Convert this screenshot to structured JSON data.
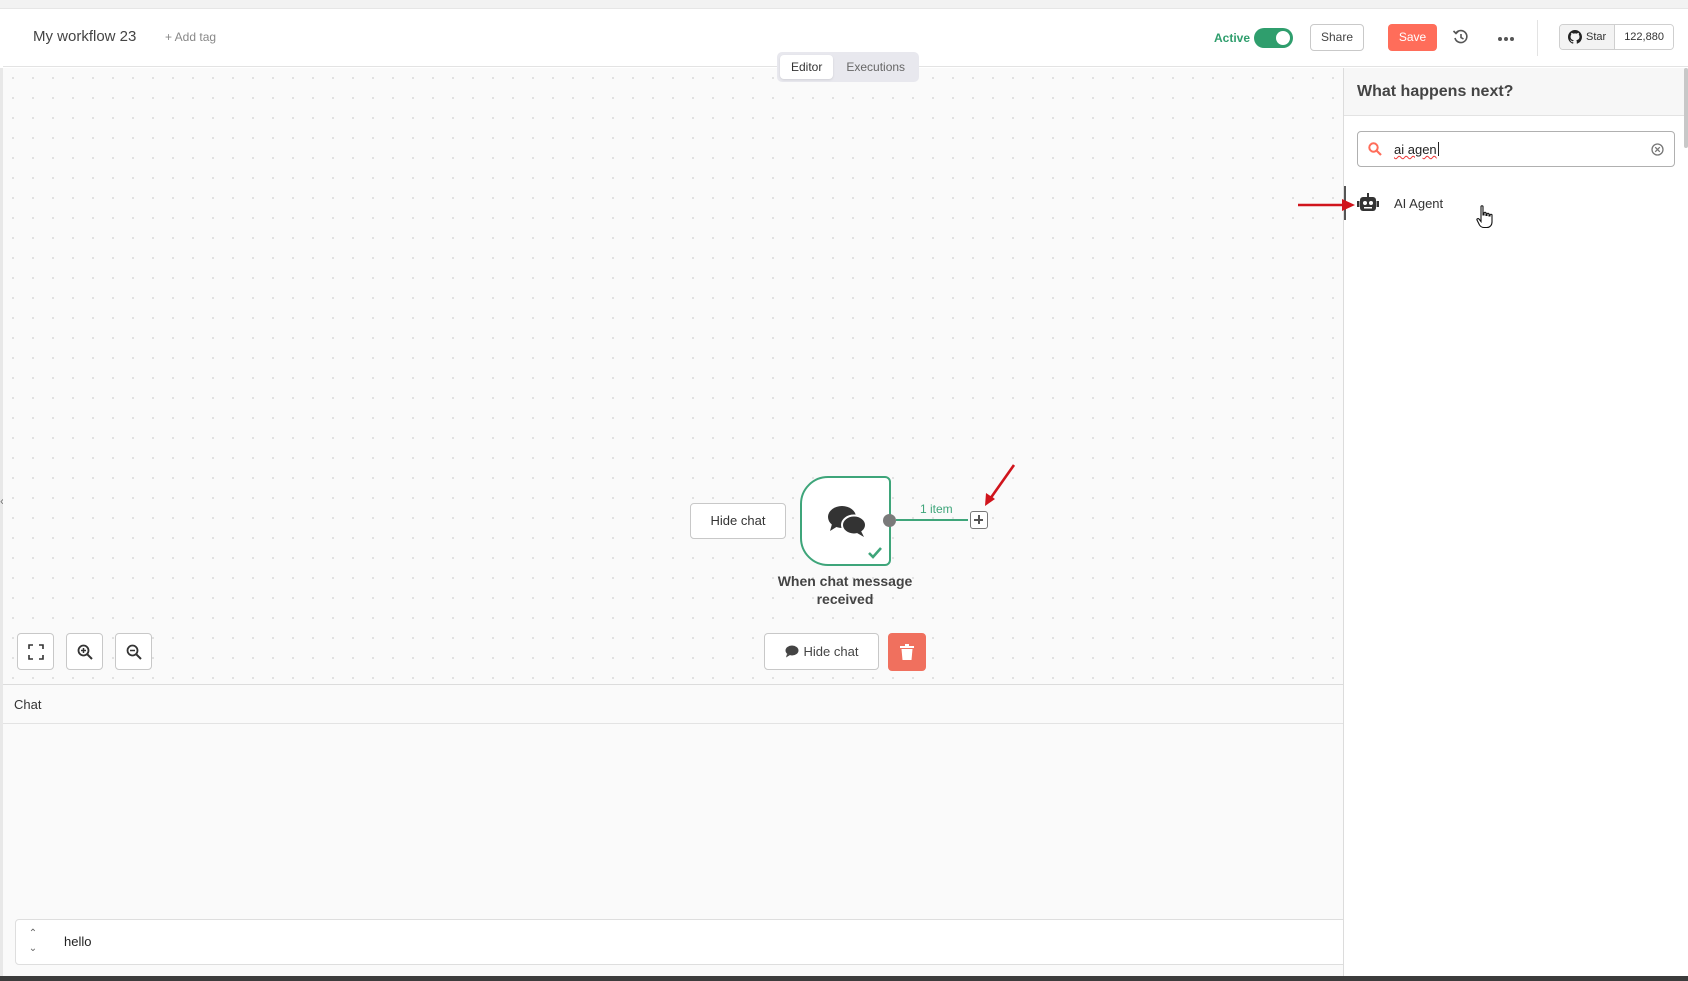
{
  "header": {
    "workflow_name": "My workflow 23",
    "add_tag": "+ Add tag",
    "active_label": "Active",
    "active": true,
    "share_label": "Share",
    "save_label": "Save",
    "github_star_label": "Star",
    "github_star_count": "122,880"
  },
  "tabs": [
    {
      "label": "Editor",
      "active": true
    },
    {
      "label": "Executions",
      "active": false
    }
  ],
  "canvas": {
    "node_hide_chat_label": "Hide chat",
    "node_title": "When chat message received",
    "node_status": "success",
    "connection_label": "1 item",
    "hide_chat_button_label": "Hide chat"
  },
  "chat": {
    "title": "Chat",
    "input_value": "hello"
  },
  "node_panel": {
    "title": "What happens next?",
    "search_value": "ai agen",
    "results": [
      {
        "label": "AI Agent",
        "icon": "robot-icon"
      }
    ]
  },
  "colors": {
    "accent_green": "#3ea57a",
    "save_orange": "#ff6d5a",
    "annotation_red": "#d0141c"
  }
}
